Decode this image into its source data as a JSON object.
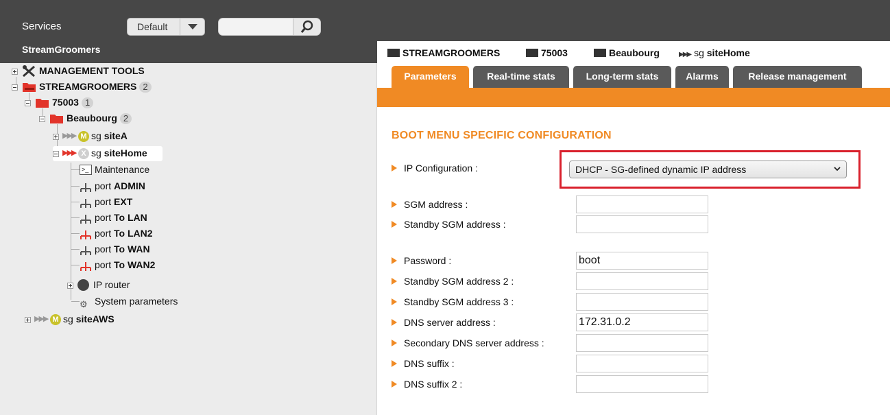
{
  "header": {
    "services_label": "Services",
    "app_name": "StreamGroomers",
    "profile_dropdown": {
      "value": "Default"
    },
    "search": {
      "placeholder": ""
    }
  },
  "tree": {
    "items": [
      {
        "label": "MANAGEMENT TOOLS",
        "icon": "tools-icon"
      },
      {
        "label": "STREAMGROOMERS",
        "count": "2",
        "icon": "folder-open-icon"
      },
      {
        "label": "75003",
        "count": "1",
        "icon": "folder-open-icon"
      },
      {
        "label": "Beaubourg",
        "count": "2",
        "icon": "folder-open-icon"
      },
      {
        "prefix": "sg",
        "label": "siteA",
        "icon": "site-icon"
      },
      {
        "prefix": "sg",
        "label": "siteHome",
        "icon": "site-icon"
      },
      {
        "label": "Maintenance",
        "icon": "terminal-icon"
      },
      {
        "prefix": "port",
        "label": "ADMIN",
        "icon": "port-icon"
      },
      {
        "prefix": "port",
        "label": "EXT",
        "icon": "port-icon"
      },
      {
        "prefix": "port",
        "label": "To LAN",
        "icon": "port-icon"
      },
      {
        "prefix": "port",
        "label": "To LAN2",
        "icon": "port-icon"
      },
      {
        "prefix": "port",
        "label": "To WAN",
        "icon": "port-icon"
      },
      {
        "prefix": "port",
        "label": "To WAN2",
        "icon": "port-icon"
      },
      {
        "label": "IP router",
        "icon": "router-icon"
      },
      {
        "label": "System parameters",
        "icon": "gears-icon"
      },
      {
        "prefix": "sg",
        "label": "siteAWS",
        "icon": "site-icon"
      }
    ]
  },
  "breadcrumb": {
    "items": [
      {
        "label": "STREAMGROOMERS"
      },
      {
        "label": "75003"
      },
      {
        "label": "Beaubourg"
      },
      {
        "prefix": "sg",
        "label": "siteHome"
      }
    ]
  },
  "tabs": [
    {
      "label": "Parameters",
      "active": true
    },
    {
      "label": "Real-time stats"
    },
    {
      "label": "Long-term stats"
    },
    {
      "label": "Alarms"
    },
    {
      "label": "Release management"
    }
  ],
  "section": {
    "title": "BOOT MENU SPECIFIC CONFIGURATION",
    "ip_configuration": {
      "label": "IP Configuration :",
      "value": "DHCP - SG-defined dynamic IP address"
    },
    "fields": [
      {
        "label": "SGM address :",
        "value": ""
      },
      {
        "label": "Standby SGM address :",
        "value": ""
      },
      {
        "label": "Password :",
        "value": "boot"
      },
      {
        "label": "Standby SGM address 2 :",
        "value": ""
      },
      {
        "label": "Standby SGM address 3 :",
        "value": ""
      },
      {
        "label": "DNS server address :",
        "value": "172.31.0.2"
      },
      {
        "label": "Secondary DNS server address :",
        "value": ""
      },
      {
        "label": "DNS suffix :",
        "value": ""
      },
      {
        "label": "DNS suffix 2 :",
        "value": ""
      }
    ]
  },
  "colors": {
    "accent": "#f08a24",
    "header_bg": "#474747",
    "tab_bg": "#5a5a5a",
    "highlight_border": "#d9202c"
  }
}
